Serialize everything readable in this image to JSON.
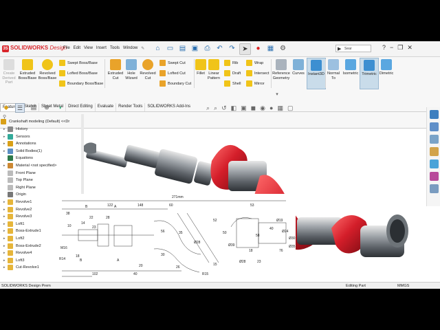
{
  "app": {
    "brand": "SOLIDWORKS",
    "edition": "Design",
    "menu": [
      "File",
      "Edit",
      "View",
      "Insert",
      "Tools",
      "Window"
    ],
    "search_text": "Sear",
    "colors": {
      "brand_red": "#d9262c",
      "accent_blue": "#2a6fb0",
      "body_red": "#d41e2a",
      "steel": "#8a8f95"
    }
  },
  "ribbon": {
    "features": [
      {
        "label": "Create\nDerived\nPart",
        "disabled": true
      },
      {
        "label": "Extruded\nBoss/Base"
      },
      {
        "label": "Revolved\nBoss/Base"
      }
    ],
    "boss_small": [
      "Swept Boss/Base",
      "Lofted Boss/Base",
      "Boundary Boss/Base"
    ],
    "cut_big": [
      "Extruded\nCut",
      "Hole\nWizard",
      "Revolved\nCut"
    ],
    "cut_small": [
      "Swept Cut",
      "Lofted Cut",
      "Boundary Cut"
    ],
    "modify_big": [
      "Fillet",
      "Linear\nPattern"
    ],
    "modify_small": [
      "Rib",
      "Draft",
      "Shell",
      "Wrap",
      "Intersect",
      "Mirror"
    ],
    "ref": [
      "Reference\nGeometry",
      "Curves",
      "Instant3D"
    ],
    "views": [
      "Normal\nTo",
      "Isometric",
      "Trimetric",
      "Dimetric"
    ]
  },
  "tabs": [
    "Features",
    "Sketch",
    "Sheet Metal",
    "Direct Editing",
    "Evaluate",
    "Render Tools",
    "SOLIDWORKS Add-Ins"
  ],
  "tree": {
    "root": "Crankshaft modeling (Default) <<Dr",
    "items": [
      "History",
      "Sensors",
      "Annotations",
      "Solid Bodies(1)",
      "Equations",
      "Material <not specified>",
      "Front Plane",
      "Top Plane",
      "Right Plane",
      "Origin",
      "Revolve1",
      "Revolve2",
      "Revolve3",
      "Loft1",
      "Boss-Extrude1",
      "Loft2",
      "Boss-Extrude2",
      "Revolve4",
      "Loft3",
      "Cut-Revolve1"
    ]
  },
  "status": {
    "left": "SOLIDWORKS Design Prem",
    "mode": "Editing Part",
    "units": "MMGS"
  },
  "drawing": {
    "dims": [
      "271mm",
      "122",
      "148",
      "53",
      "60",
      "28",
      "22",
      "14",
      "38",
      "23",
      "10",
      "18",
      "B",
      "A",
      "B",
      "A",
      "30",
      "20",
      "26",
      "35",
      "56",
      "52",
      "50",
      "58",
      "40",
      "18",
      "76",
      "23",
      "102",
      "40",
      "15",
      "R15",
      "Ø28",
      "Ø39",
      "Ø28",
      "Ø19",
      "Ø24",
      "Ø30",
      "Ø35",
      "M16",
      "R14"
    ]
  }
}
